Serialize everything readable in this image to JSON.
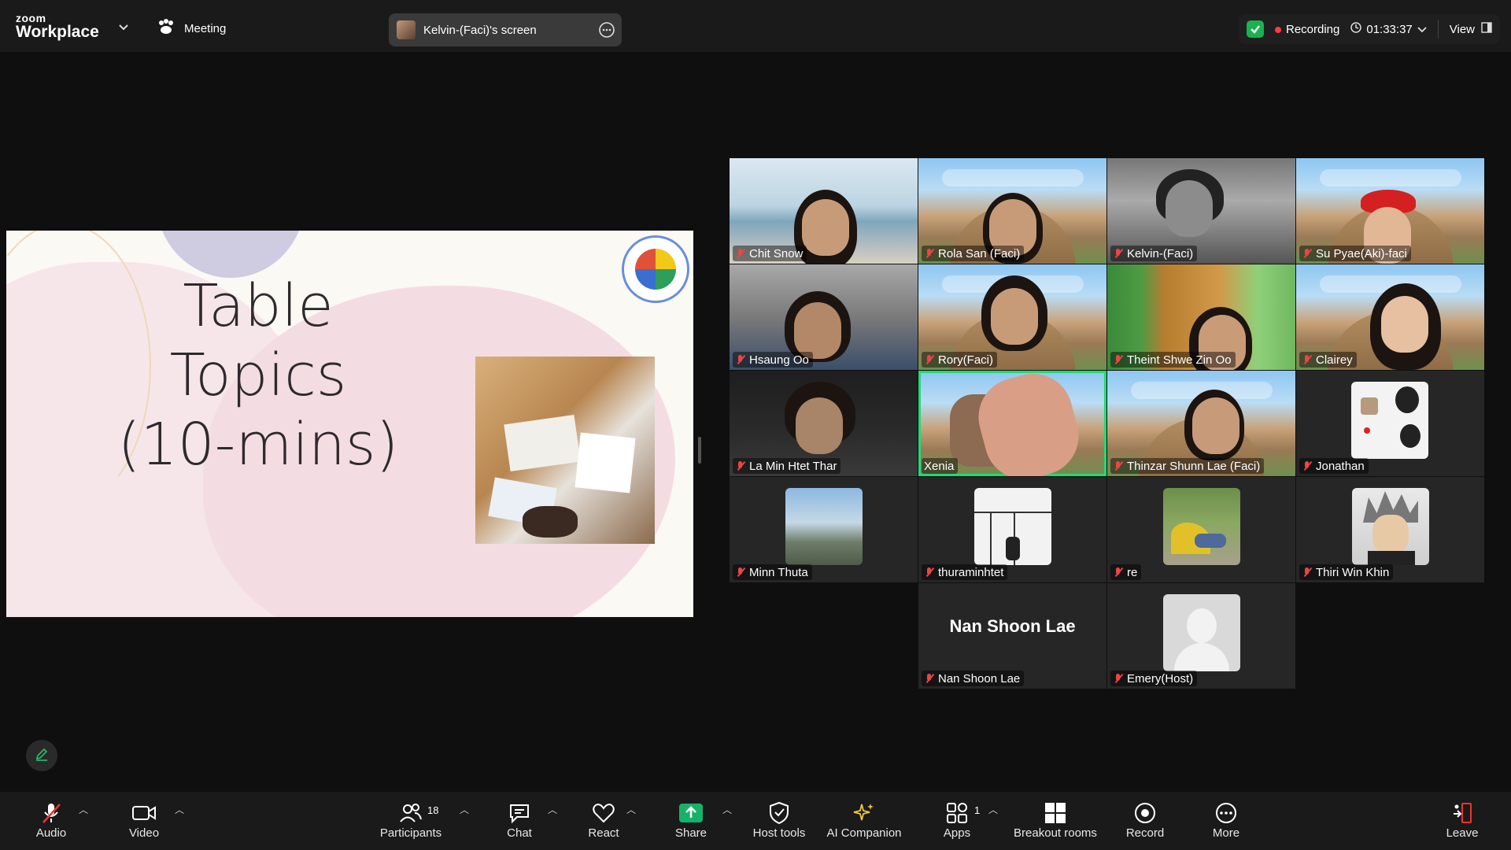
{
  "app": {
    "brand_small": "zoom",
    "brand_big": "Workplace",
    "meeting_label": "Meeting",
    "screen_share_label": "Kelvin-(Faci)'s screen",
    "recording_label": "Recording",
    "timer": "01:33:37",
    "view_label": "View",
    "accent_green": "#23d977",
    "record_red": "#ff3b3b"
  },
  "slide": {
    "title_line1": "Table Topics",
    "title_line2": "(10-mins)"
  },
  "gallery": {
    "participants": [
      {
        "name": "Chit Snow"
      },
      {
        "name": "Rola San (Faci)"
      },
      {
        "name": "Kelvin-(Faci)"
      },
      {
        "name": "Su Pyae(Aki)-faci"
      },
      {
        "name": "Hsaung Oo"
      },
      {
        "name": "Rory(Faci)"
      },
      {
        "name": "Theint Shwe Zin Oo"
      },
      {
        "name": "Clairey"
      },
      {
        "name": "La Min Htet Thar"
      },
      {
        "name": "Xenia"
      },
      {
        "name": "Thinzar Shunn Lae (Faci)"
      },
      {
        "name": "Jonathan"
      },
      {
        "name": "Minn Thuta"
      },
      {
        "name": "thuraminhtet"
      },
      {
        "name": "re"
      },
      {
        "name": "Thiri Win Khin"
      },
      {
        "name": "Nan Shoon Lae",
        "display_name": "Nan Shoon Lae"
      },
      {
        "name": "Emery(Host)"
      }
    ]
  },
  "toolbar": {
    "audio": "Audio",
    "video": "Video",
    "participants": "Participants",
    "participants_count": "18",
    "chat": "Chat",
    "react": "React",
    "share": "Share",
    "host_tools": "Host tools",
    "ai_companion": "AI Companion",
    "apps": "Apps",
    "apps_count": "1",
    "breakout_rooms": "Breakout rooms",
    "record": "Record",
    "more": "More",
    "leave": "Leave"
  }
}
